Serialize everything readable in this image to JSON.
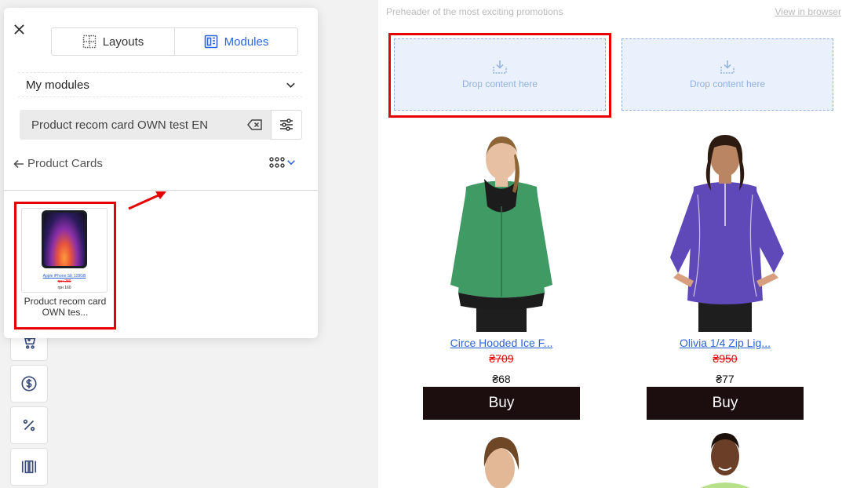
{
  "panel": {
    "tabs": [
      {
        "label": "Layouts",
        "active": false
      },
      {
        "label": "Modules",
        "active": true
      }
    ],
    "section_title": "My modules",
    "search": {
      "value": "Product recom card OWN test EN"
    },
    "back_label": "Product Cards",
    "module_card": {
      "label": "Product recom card OWN tes...",
      "thumb_name": "Apple iPhone SE 128GB",
      "thumb_old_price": "грн 280",
      "thumb_new_price": "грн 160"
    }
  },
  "toolbar": {
    "tools": [
      {
        "icon": "cart-icon"
      },
      {
        "icon": "dollar-icon"
      },
      {
        "icon": "percent-icon"
      },
      {
        "icon": "columns-icon"
      }
    ]
  },
  "email": {
    "preheader": "Preheader of the most exciting promotions",
    "view_in_browser": "View in browser",
    "drop_zones": [
      {
        "label": "Drop content here"
      },
      {
        "label": "Drop content here"
      }
    ],
    "products": [
      {
        "name": "Circe Hooded Ice F...",
        "old_price": "₴709",
        "price": "₴68",
        "button": "Buy",
        "color": "#3f9a63"
      },
      {
        "name": "Olivia 1/4 Zip Lig...",
        "old_price": "₴950",
        "price": "₴77",
        "button": "Buy",
        "color": "#5f48b8"
      }
    ]
  },
  "colors": {
    "accent": "#2b63d9",
    "highlight": "#e60000",
    "buy_button": "#1c0e0e",
    "drop_zone": "#eaf1fc"
  }
}
